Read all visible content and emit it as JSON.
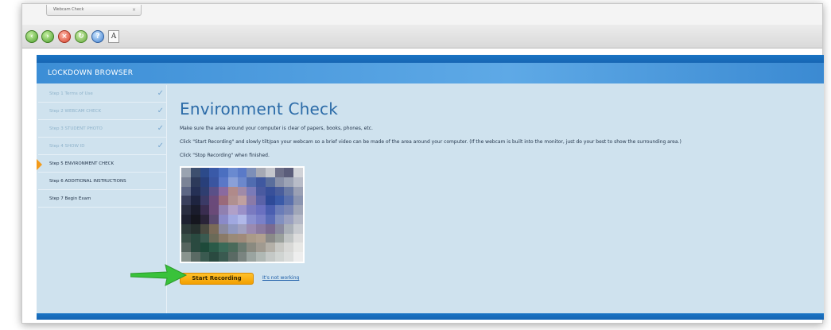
{
  "browser": {
    "tab_title": "Webcam Check",
    "tab_close": "×",
    "toolbar": {
      "back_icon": "back-arrow-icon",
      "forward_icon": "forward-arrow-icon",
      "stop_icon": "stop-icon",
      "reload_icon": "reload-icon",
      "help_icon": "help-icon",
      "font_label": "A"
    }
  },
  "header": {
    "title": "LOCKDOWN BROWSER"
  },
  "sidebar": {
    "steps": [
      {
        "label": "Step 1   Terms of Use",
        "status": "done"
      },
      {
        "label": "Step 2   WEBCAM CHECK",
        "status": "done"
      },
      {
        "label": "Step 3   STUDENT PHOTO",
        "status": "done"
      },
      {
        "label": "Step 4   SHOW ID",
        "status": "done"
      },
      {
        "label": "Step 5   ENVIRONMENT CHECK",
        "status": "current"
      },
      {
        "label": "Step 6   ADDITIONAL INSTRUCTIONS",
        "status": "todo"
      },
      {
        "label": "Step 7   Begin Exam",
        "status": "todo"
      }
    ],
    "check_glyph": "✓"
  },
  "main": {
    "title": "Environment Check",
    "instructions": [
      "Make sure the area around your computer is clear of papers, books, phones, etc.",
      "Click \"Start Recording\" and slowly tilt/pan your webcam so a brief video can be made of the area around your computer. (If the webcam is built into the monitor, just do your best to show the surrounding area.)",
      "Click \"Stop Recording\" when finished."
    ],
    "start_button": "Start Recording",
    "not_working_link": "It's not working"
  },
  "colors": {
    "accent_blue": "#2b6ba8",
    "header_blue": "#3c8ed6",
    "button_orange": "#f3a000",
    "pointer_green": "#39c23a"
  }
}
